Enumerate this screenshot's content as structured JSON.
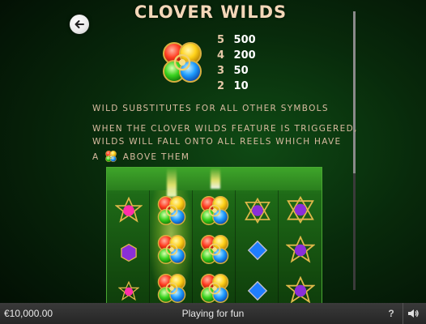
{
  "header": {
    "title": "CLOVER WILDS",
    "back_icon": "back-arrow-icon"
  },
  "wild_symbol": {
    "icon": "four-leaf-clover-gem-icon",
    "payouts": [
      {
        "count": "5",
        "value": "500"
      },
      {
        "count": "4",
        "value": "200"
      },
      {
        "count": "3",
        "value": "50"
      },
      {
        "count": "2",
        "value": "10"
      }
    ]
  },
  "rules": {
    "line1": "WILD SUBSTITUTES FOR ALL OTHER SYMBOLS",
    "line2": "WHEN THE CLOVER WILDS FEATURE IS TRIGGERED,",
    "line3": "WILDS WILL FALL ONTO ALL REELS WHICH HAVE",
    "line4_prefix": "A",
    "line4_suffix": "ABOVE THEM"
  },
  "reel_preview": {
    "reels": [
      [
        "star-gem-pink",
        "hex-gem-purple",
        "star-gem-pink"
      ],
      [
        "clover-wild",
        "clover-wild",
        "clover-wild"
      ],
      [
        "clover-wild",
        "clover-wild",
        "clover-wild"
      ],
      [
        "triangle-gem-purple",
        "diamond-gem-blue",
        "diamond-gem-blue"
      ],
      [
        "triangle-gem-purple",
        "star-gem-purple",
        "star-gem-purple"
      ]
    ]
  },
  "footer": {
    "balance": "€10,000.00",
    "mode": "Playing for fun",
    "help_label": "?",
    "sound_icon": "speaker-icon"
  },
  "colors": {
    "title": "#f3d7b8",
    "rule_text": "#d9bba0",
    "background": "#082a0b",
    "footer_bar": "#2e2e2e"
  }
}
